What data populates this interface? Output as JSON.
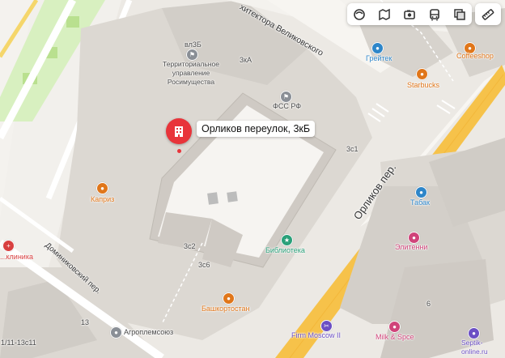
{
  "toolbar": {
    "buttons": [
      {
        "name": "layers-icon"
      },
      {
        "name": "panorama-icon"
      },
      {
        "name": "photo-icon"
      },
      {
        "name": "transit-icon"
      },
      {
        "name": "map-layers-icon"
      }
    ],
    "ruler": "ruler-icon"
  },
  "selected": {
    "title": "Орликов переулок, 3кБ"
  },
  "streets": {
    "velikovskogo": "хитектора Великовского",
    "orlikov": "Орликов пер.",
    "dominikovsky": "Доминиковский пер."
  },
  "buildings": {
    "vl3b": "вл3Б",
    "k3ka": "3кА",
    "k3c1": "3с1",
    "k3c2": "3с2",
    "k3c6": "3с6",
    "n13": "13",
    "n6": "6",
    "n1_11": "1/11-13с11"
  },
  "poi": {
    "rosimushchestvo": "Территориальное управление Росимущества",
    "fss": "ФСС РФ",
    "greytek": "Грейтек",
    "coffeeshop": "Coffeeshop",
    "starbucks": "Starbucks",
    "kapriz": "Каприз",
    "biblioteka": "Библиотека",
    "bashkortostan": "Башкортостан",
    "tabak": "Табак",
    "elitenny": "Элитенни",
    "klinika": "...клиника",
    "agropromsoyuz": "Агроплемсоюз",
    "firm_moscow": "Firm Moscow II",
    "milk_spice": "Milk & Spce",
    "septik": "Septik-online.ru"
  },
  "colors": {
    "pin": "#e8343a",
    "major_road": "#f6c24a",
    "park": "#cdeaa5",
    "building": "#d7d3cd"
  }
}
